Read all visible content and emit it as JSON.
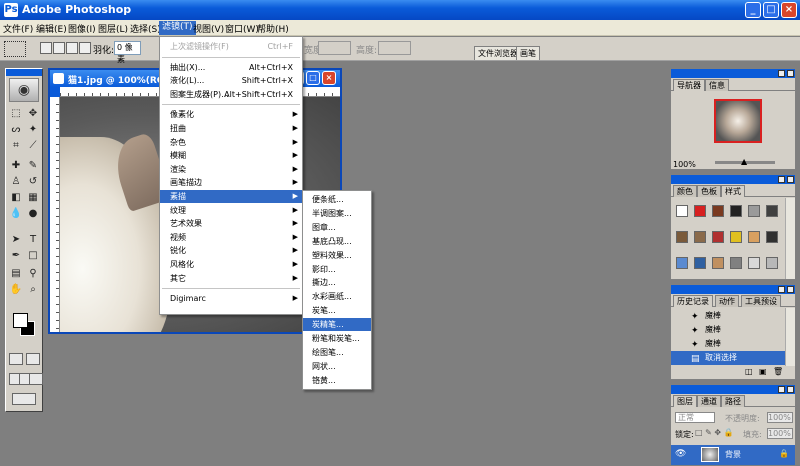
{
  "window": {
    "title": "Adobe Photoshop",
    "app_icon": "photoshop-icon",
    "controls": [
      "_",
      "□",
      "×"
    ]
  },
  "menubar": [
    {
      "label": "文件(F)"
    },
    {
      "label": "编辑(E)"
    },
    {
      "label": "图像(I)"
    },
    {
      "label": "图层(L)"
    },
    {
      "label": "选择(S)"
    },
    {
      "label": "滤镜(T)",
      "active": true
    },
    {
      "label": "视图(V)"
    },
    {
      "label": "窗口(W)"
    },
    {
      "label": "帮助(H)"
    }
  ],
  "options": {
    "feather_label": "羽化:",
    "feather_value": "0 像素",
    "width_label": "宽度:",
    "height_label": "高度:",
    "well_tabs": [
      "文件浏览器",
      "画笔"
    ]
  },
  "document": {
    "title": "猫1.jpg @ 100%(RGB)"
  },
  "filter_menu": {
    "items": [
      {
        "label": "上次滤镜操作(F)",
        "shortcut": "Ctrl+F",
        "disabled": true
      },
      {
        "sep": true
      },
      {
        "label": "抽出(X)...",
        "shortcut": "Alt+Ctrl+X"
      },
      {
        "label": "液化(L)...",
        "shortcut": "Shift+Ctrl+X"
      },
      {
        "label": "图案生成器(P)...",
        "shortcut": "Alt+Shift+Ctrl+X"
      },
      {
        "sep": true
      },
      {
        "label": "像素化",
        "submenu": true
      },
      {
        "label": "扭曲",
        "submenu": true
      },
      {
        "label": "杂色",
        "submenu": true
      },
      {
        "label": "模糊",
        "submenu": true
      },
      {
        "label": "渲染",
        "submenu": true
      },
      {
        "label": "画笔描边",
        "submenu": true
      },
      {
        "label": "素描",
        "submenu": true,
        "highlight": true
      },
      {
        "label": "纹理",
        "submenu": true
      },
      {
        "label": "艺术效果",
        "submenu": true
      },
      {
        "label": "视频",
        "submenu": true
      },
      {
        "label": "锐化",
        "submenu": true
      },
      {
        "label": "风格化",
        "submenu": true
      },
      {
        "label": "其它",
        "submenu": true
      },
      {
        "sep": true
      },
      {
        "label": "Digimarc",
        "submenu": true
      }
    ]
  },
  "sketch_submenu": {
    "items": [
      {
        "label": "便条纸..."
      },
      {
        "label": "半调图案..."
      },
      {
        "label": "图章..."
      },
      {
        "label": "基底凸现..."
      },
      {
        "label": "塑料效果..."
      },
      {
        "label": "影印..."
      },
      {
        "label": "撕边..."
      },
      {
        "label": "水彩画纸..."
      },
      {
        "label": "炭笔..."
      },
      {
        "label": "炭精笔...",
        "highlight": true
      },
      {
        "label": "粉笔和炭笔..."
      },
      {
        "label": "绘图笔..."
      },
      {
        "label": "网状..."
      },
      {
        "label": "铬黄..."
      }
    ]
  },
  "navigator": {
    "tabs": [
      "导航器",
      "信息"
    ],
    "zoom": "100%"
  },
  "swatches_palette": {
    "tabs": [
      "颜色",
      "色板",
      "样式"
    ],
    "swatches": [
      "#ffffff",
      "#d62020",
      "#7a3a20",
      "#222222",
      "#9a9a9a",
      "#404040",
      "#7a5a3a",
      "#8a6a4a",
      "#b03030",
      "#e0c020",
      "#d8a060",
      "#303030",
      "#5a8ad0",
      "#3060a0",
      "#c09060",
      "#808080",
      "#d8d8d8",
      "#b8b8b8"
    ]
  },
  "history": {
    "tabs": [
      "历史记录",
      "动作",
      "工具预设"
    ],
    "rows": [
      {
        "label": "魔棒",
        "icon": "magic-wand-icon"
      },
      {
        "label": "魔棒",
        "icon": "magic-wand-icon"
      },
      {
        "label": "魔棒",
        "icon": "magic-wand-icon"
      },
      {
        "label": "取消选择",
        "icon": "document-icon",
        "highlight": true
      }
    ]
  },
  "layers": {
    "tabs": [
      "图层",
      "通道",
      "路径"
    ],
    "blend_mode": "正常",
    "opacity_label": "不透明度:",
    "opacity_value": "100%",
    "lock_label": "锁定:",
    "fill_label": "填充:",
    "fill_value": "100%",
    "layer_name": "背景"
  }
}
